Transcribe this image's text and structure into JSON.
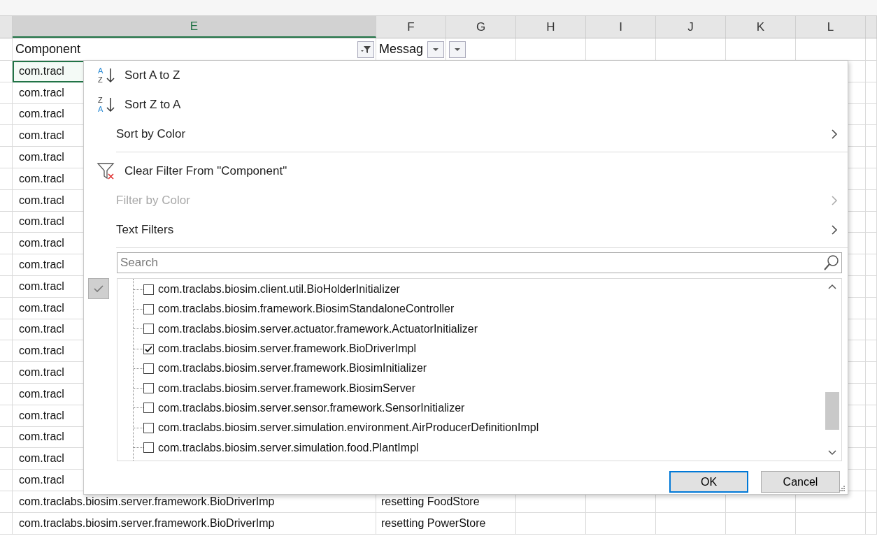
{
  "columns": [
    {
      "letter": "E",
      "selected": true
    },
    {
      "letter": "F",
      "selected": false
    },
    {
      "letter": "G",
      "selected": false
    },
    {
      "letter": "H",
      "selected": false
    },
    {
      "letter": "I",
      "selected": false
    },
    {
      "letter": "J",
      "selected": false
    },
    {
      "letter": "K",
      "selected": false
    },
    {
      "letter": "L",
      "selected": false
    }
  ],
  "filter_row": [
    {
      "text": "Component",
      "filter_active": true
    },
    {
      "text": "Messag",
      "filter_active": false
    },
    {
      "filter_active": false
    }
  ],
  "rows": [
    {
      "component": "com.tracl",
      "selected": true
    },
    {
      "component": "com.tracl",
      "selected": false
    },
    {
      "component": "com.tracl",
      "selected": false
    },
    {
      "component": "com.tracl",
      "selected": false
    },
    {
      "component": "com.tracl",
      "selected": false
    },
    {
      "component": "com.tracl",
      "selected": false
    },
    {
      "component": "com.tracl",
      "selected": false
    },
    {
      "component": "com.tracl",
      "selected": false
    },
    {
      "component": "com.tracl",
      "selected": false
    },
    {
      "component": "com.tracl",
      "selected": false
    },
    {
      "component": "com.tracl",
      "selected": false
    },
    {
      "component": "com.tracl",
      "selected": false
    },
    {
      "component": "com.tracl",
      "selected": false
    },
    {
      "component": "com.tracl",
      "selected": false
    },
    {
      "component": "com.tracl",
      "selected": false
    },
    {
      "component": "com.tracl",
      "selected": false
    },
    {
      "component": "com.tracl",
      "selected": false
    },
    {
      "component": "com.tracl",
      "selected": false
    },
    {
      "component": "com.tracl",
      "selected": false
    },
    {
      "component": "com.tracl",
      "selected": false
    },
    {
      "component": "com.traclabs.biosim.server.framework.BioDriverImp",
      "message": "resetting FoodStore",
      "selected": false
    },
    {
      "component": "com.traclabs.biosim.server.framework.BioDriverImp",
      "message": "resetting PowerStore",
      "selected": false
    }
  ],
  "filter_menu": {
    "items": [
      {
        "kind": "sort-asc",
        "label": "Sort A to Z",
        "disabled": false,
        "submenu": false,
        "icon_letters": [
          "A",
          "Z"
        ]
      },
      {
        "kind": "sort-desc",
        "label": "Sort Z to A",
        "disabled": false,
        "submenu": false,
        "icon_letters": [
          "Z",
          "A"
        ]
      },
      {
        "kind": "plain",
        "label": "Sort by Color",
        "disabled": false,
        "submenu": true
      },
      {
        "kind": "separator"
      },
      {
        "kind": "clear-filter",
        "label": "Clear Filter From \"Component\"",
        "disabled": false,
        "submenu": false
      },
      {
        "kind": "plain",
        "label": "Filter by Color",
        "disabled": true,
        "submenu": true
      },
      {
        "kind": "plain",
        "label": "Text Filters",
        "disabled": false,
        "submenu": true
      },
      {
        "kind": "separator"
      }
    ],
    "search": {
      "placeholder": "Search"
    },
    "values": [
      {
        "label": "com.traclabs.biosim.client.util.BioHolderInitializer",
        "checked": false
      },
      {
        "label": "com.traclabs.biosim.framework.BiosimStandaloneController",
        "checked": false
      },
      {
        "label": "com.traclabs.biosim.server.actuator.framework.ActuatorInitializer",
        "checked": false
      },
      {
        "label": "com.traclabs.biosim.server.framework.BioDriverImpl",
        "checked": true
      },
      {
        "label": "com.traclabs.biosim.server.framework.BiosimInitializer",
        "checked": false
      },
      {
        "label": "com.traclabs.biosim.server.framework.BiosimServer",
        "checked": false
      },
      {
        "label": "com.traclabs.biosim.server.sensor.framework.SensorInitializer",
        "checked": false
      },
      {
        "label": "com.traclabs.biosim.server.simulation.environment.AirProducerDefinitionImpl",
        "checked": false
      },
      {
        "label": "com.traclabs.biosim.server.simulation.food.PlantImpl",
        "checked": false
      }
    ],
    "buttons": [
      {
        "label": "OK",
        "default": true
      },
      {
        "label": "Cancel",
        "default": false
      }
    ]
  }
}
